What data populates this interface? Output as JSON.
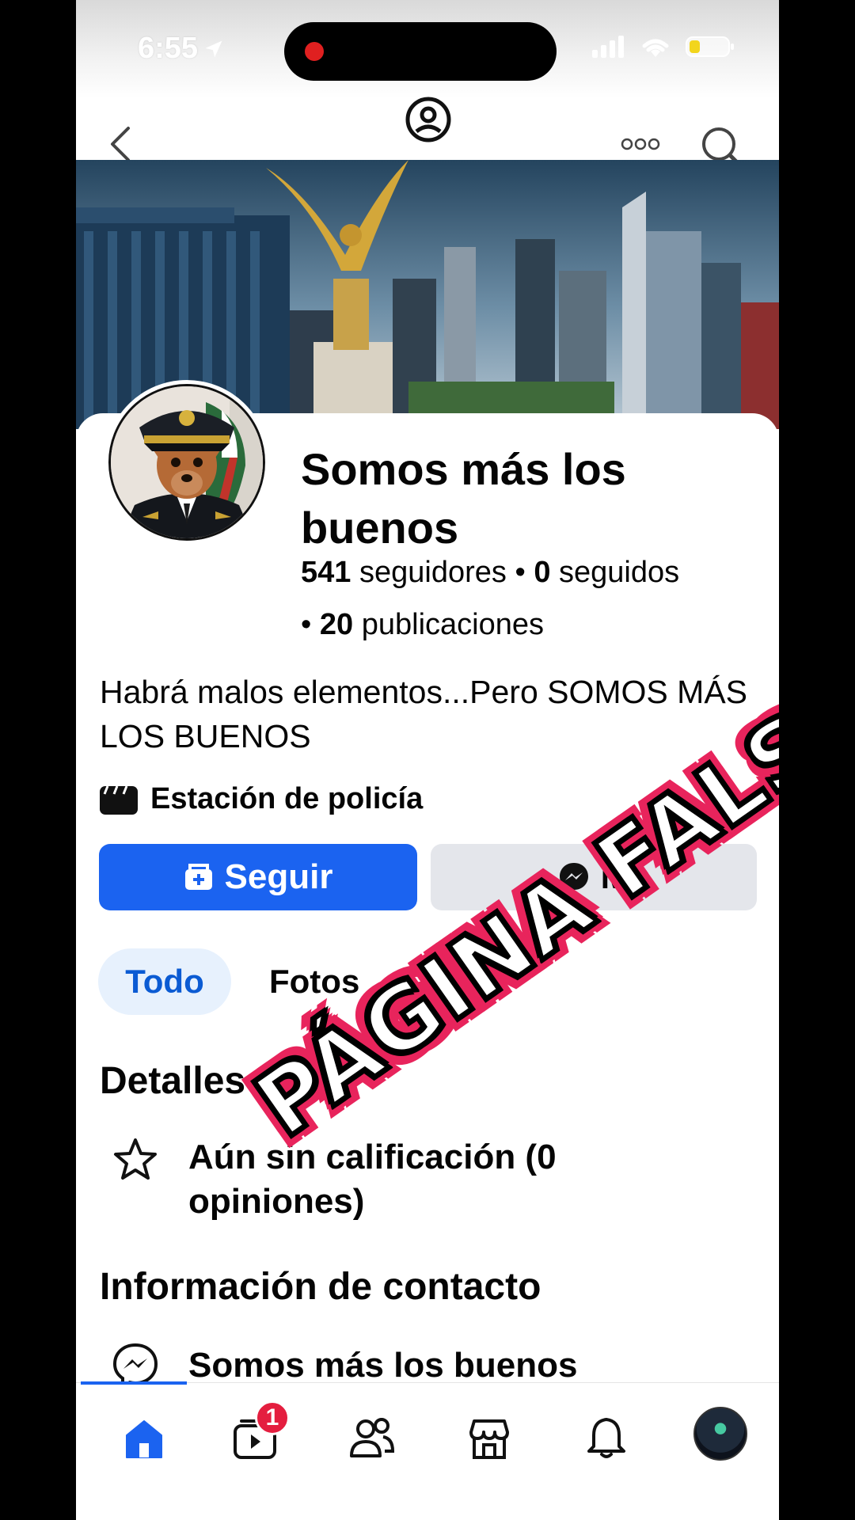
{
  "status_bar": {
    "time": "6:55"
  },
  "page": {
    "name": "Somos más los buenos",
    "followers_count": "541",
    "followers_label": "seguidores",
    "following_count": "0",
    "following_label": "seguidos",
    "posts_count": "20",
    "posts_label": "publicaciones",
    "bio": "Habrá malos elementos...Pero SOMOS MÁS LOS BUENOS",
    "category": "Estación de policía"
  },
  "actions": {
    "follow_label": "Seguir",
    "message_label": "M"
  },
  "tabs": [
    {
      "label": "Todo"
    },
    {
      "label": "Fotos"
    }
  ],
  "details": {
    "title": "Detalles",
    "rating": "Aún sin calificación (0 opiniones)"
  },
  "contact": {
    "title": "Información de contacto",
    "messenger_name": "Somos más los buenos"
  },
  "bottom_nav": {
    "video_badge": "1"
  },
  "overlay": {
    "text": "PÁGINA FALSA"
  },
  "colors": {
    "accent": "#1b63f0",
    "badge": "#e41e3f",
    "stamp_border": "#e8245c"
  }
}
